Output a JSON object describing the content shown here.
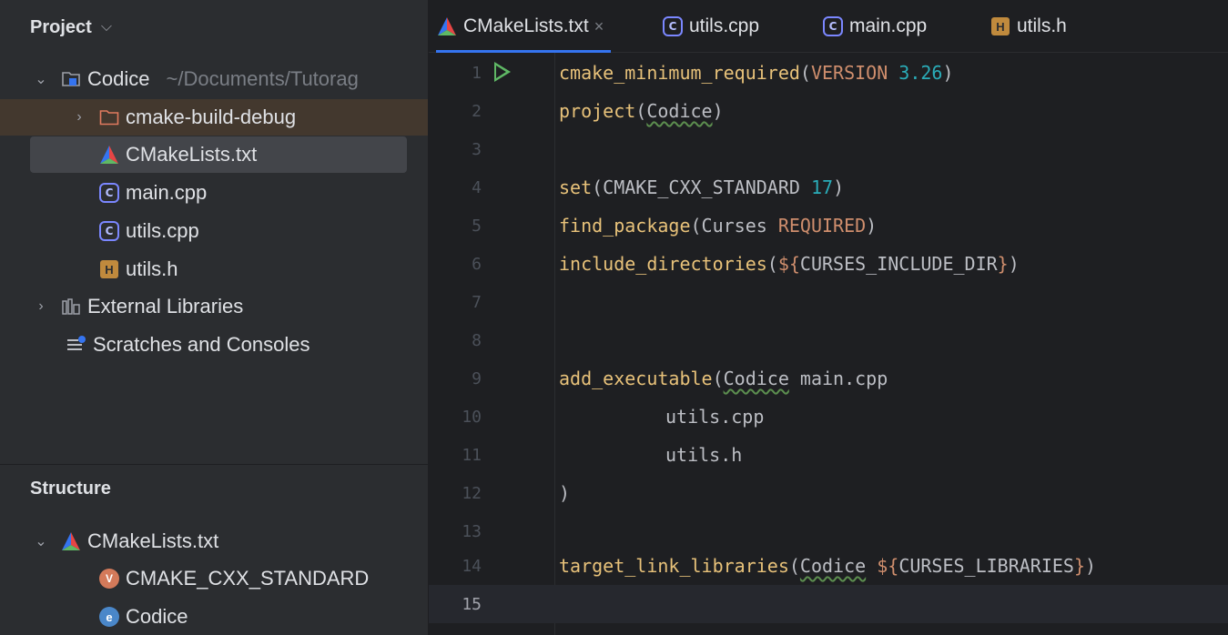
{
  "project_panel": {
    "title": "Project",
    "tree": [
      {
        "label": "Codice",
        "path": "~/Documents/Tutorag"
      },
      {
        "label": "cmake-build-debug"
      },
      {
        "label": "CMakeLists.txt"
      },
      {
        "label": "main.cpp"
      },
      {
        "label": "utils.cpp"
      },
      {
        "label": "utils.h"
      },
      {
        "label": "External Libraries"
      },
      {
        "label": "Scratches and Consoles"
      }
    ]
  },
  "structure_panel": {
    "title": "Structure",
    "items": [
      {
        "label": "CMakeLists.txt"
      },
      {
        "label": "CMAKE_CXX_STANDARD"
      },
      {
        "label": "Codice"
      }
    ]
  },
  "tabs": [
    {
      "label": "CMakeLists.txt",
      "close": "×"
    },
    {
      "label": "utils.cpp"
    },
    {
      "label": "main.cpp"
    },
    {
      "label": "utils.h"
    }
  ],
  "editor": {
    "line_numbers": [
      "1",
      "2",
      "3",
      "4",
      "5",
      "6",
      "7",
      "8",
      "9",
      "10",
      "11",
      "12",
      "13",
      "14",
      "15"
    ],
    "current_line": "15",
    "tokens": {
      "l1_fn": "cmake_minimum_required",
      "l1_open": "(",
      "l1_kw": "VERSION",
      "l1_num": "3.26",
      "l1_close": ")",
      "l2_fn": "project",
      "l2_open": "(",
      "l2_arg": "Codice",
      "l2_close": ")",
      "l4_fn": "set",
      "l4_open": "(",
      "l4_arg": "CMAKE_CXX_STANDARD",
      "l4_num": "17",
      "l4_close": ")",
      "l5_fn": "find_package",
      "l5_open": "(",
      "l5_arg": "Curses",
      "l5_kw": "REQUIRED",
      "l5_close": ")",
      "l6_fn": "include_directories",
      "l6_open": "(",
      "l6_var_open": "${",
      "l6_var": "CURSES_INCLUDE_DIR",
      "l6_var_close": "}",
      "l6_close": ")",
      "l9_fn": "add_executable",
      "l9_open": "(",
      "l9_arg": "Codice",
      "l9_rest": "main.cpp",
      "l10": "utils.cpp",
      "l11": "utils.h",
      "l12": ")",
      "l14_fn": "target_link_libraries",
      "l14_open": "(",
      "l14_arg": "Codice",
      "l14_var_open": "${",
      "l14_var": "CURSES_LIBRARIES",
      "l14_var_close": "}",
      "l14_close": ")"
    }
  }
}
